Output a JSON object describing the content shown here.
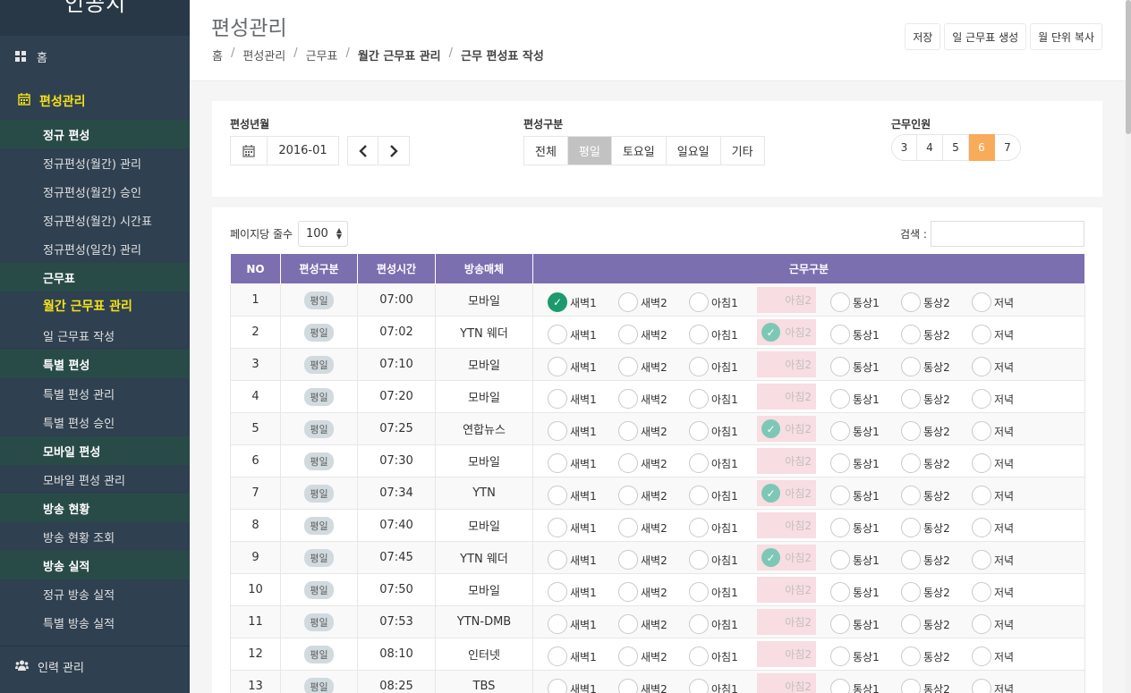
{
  "sidebar": {
    "logo": "인공지",
    "home": "홈",
    "main_menu": "편성관리",
    "items": [
      {
        "label": "정규 편성",
        "type": "group"
      },
      {
        "label": "정규편성(월간) 관리",
        "type": "item"
      },
      {
        "label": "정규편성(월간) 승인",
        "type": "item"
      },
      {
        "label": "정규편성(월간) 시간표",
        "type": "item"
      },
      {
        "label": "정규편성(일간) 관리",
        "type": "item"
      },
      {
        "label": "근무표",
        "type": "group"
      },
      {
        "label": "월간 근무표 관리",
        "type": "active"
      },
      {
        "label": "일 근무표 작성",
        "type": "item"
      },
      {
        "label": "특별 편성",
        "type": "group"
      },
      {
        "label": "특별 편성 관리",
        "type": "item"
      },
      {
        "label": "특별 편성 승인",
        "type": "item"
      },
      {
        "label": "모바일 편성",
        "type": "group"
      },
      {
        "label": "모바일 편성 관리",
        "type": "item"
      },
      {
        "label": "방송 현황",
        "type": "group"
      },
      {
        "label": "방송 현황 조회",
        "type": "item"
      },
      {
        "label": "방송 실적",
        "type": "group"
      },
      {
        "label": "정규 방송 실적",
        "type": "item"
      },
      {
        "label": "특별 방송 실적",
        "type": "item"
      }
    ],
    "bottom": "인력 관리"
  },
  "header": {
    "title": "편성관리",
    "breadcrumb": [
      "홈",
      "편성관리",
      "근무표",
      "월간 근무표 관리",
      "근무 편성표 작성"
    ],
    "buttons": [
      "저장",
      "일 근무표 생성",
      "월 단위 복사"
    ]
  },
  "filter": {
    "month_label": "편성년월",
    "month_value": "2016-01",
    "type_label": "편성구분",
    "types": [
      "전체",
      "평일",
      "토요일",
      "일요일",
      "기타"
    ],
    "active_type": "평일",
    "staff_label": "근무인원",
    "staff_options": [
      "3",
      "4",
      "5",
      "6",
      "7"
    ],
    "active_staff": "6"
  },
  "table": {
    "page_size_label": "페이지당 줄수",
    "page_size": "100",
    "search_label": "검색 :",
    "columns": [
      "NO",
      "편성구분",
      "편성시간",
      "방송매체",
      "근무구분"
    ],
    "shift_options": [
      "새벽1",
      "새벽2",
      "아침1",
      "아침2",
      "통상1",
      "통상2",
      "저녁"
    ],
    "rows": [
      {
        "no": "1",
        "type": "평일",
        "time": "07:00",
        "media": "모바일",
        "checked": "새벽1"
      },
      {
        "no": "2",
        "type": "평일",
        "time": "07:02",
        "media": "YTN 웨더",
        "checked": "아침2"
      },
      {
        "no": "3",
        "type": "평일",
        "time": "07:10",
        "media": "모바일",
        "checked": ""
      },
      {
        "no": "4",
        "type": "평일",
        "time": "07:20",
        "media": "모바일",
        "checked": ""
      },
      {
        "no": "5",
        "type": "평일",
        "time": "07:25",
        "media": "연합뉴스",
        "checked": "아침2"
      },
      {
        "no": "6",
        "type": "평일",
        "time": "07:30",
        "media": "모바일",
        "checked": ""
      },
      {
        "no": "7",
        "type": "평일",
        "time": "07:34",
        "media": "YTN",
        "checked": "아침2"
      },
      {
        "no": "8",
        "type": "평일",
        "time": "07:40",
        "media": "모바일",
        "checked": ""
      },
      {
        "no": "9",
        "type": "평일",
        "time": "07:45",
        "media": "YTN 웨더",
        "checked": "아침2"
      },
      {
        "no": "10",
        "type": "평일",
        "time": "07:50",
        "media": "모바일",
        "checked": ""
      },
      {
        "no": "11",
        "type": "평일",
        "time": "07:53",
        "media": "YTN-DMB",
        "checked": ""
      },
      {
        "no": "12",
        "type": "평일",
        "time": "08:10",
        "media": "인터넷",
        "checked": ""
      },
      {
        "no": "13",
        "type": "평일",
        "time": "08:25",
        "media": "TBS",
        "checked": ""
      }
    ]
  },
  "colors": {
    "sidebar_bg": "#2f4050",
    "group_bg": "#284b48",
    "accent_yellow": "#f4e21a",
    "table_header": "#7b6fb0",
    "active_page": "#f8ac59",
    "check_green": "#1c9a6d",
    "disabled_pink": "#f8dde2"
  },
  "icons": {
    "home": "grid-icon",
    "main_menu": "calendar-icon",
    "bottom": "users-icon",
    "date": "calendar-icon",
    "prev": "chevron-left-icon",
    "next": "chevron-right-icon"
  }
}
